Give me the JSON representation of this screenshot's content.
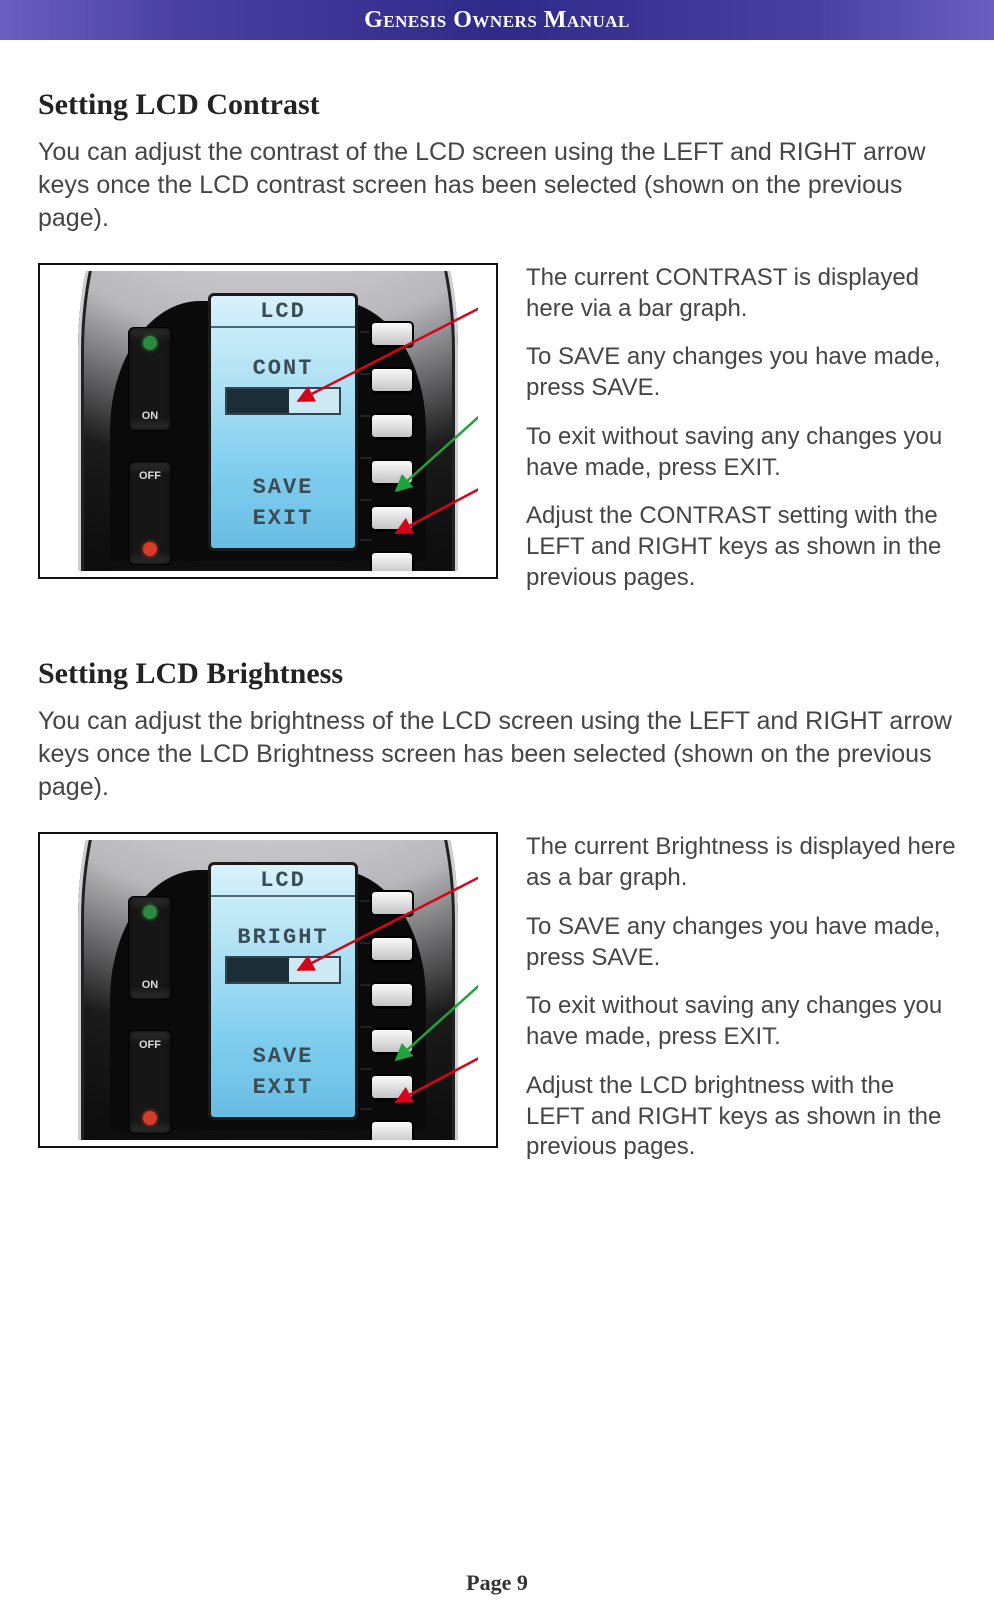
{
  "header": {
    "title": "Genesis Owners Manual"
  },
  "footer": {
    "page_label": "Page 9"
  },
  "section1": {
    "heading": "Setting LCD Contrast",
    "intro": "You can adjust the contrast of the LCD screen using the LEFT and RIGHT arrow keys once the LCD contrast screen has been selected (shown on the previous page).",
    "device": {
      "panel_title": "LCD",
      "field_label": "CONT",
      "save_label": "SAVE",
      "exit_label": "EXIT",
      "on_label": "ON",
      "off_label": "OFF"
    },
    "notes": {
      "n1": "The current CONTRAST is displayed here via a bar graph.",
      "n2": "To SAVE any changes you have made, press SAVE.",
      "n3": "To exit without saving any changes you have made, press EXIT.",
      "n4": "Adjust the CONTRAST setting with the LEFT and RIGHT keys as shown in the previous pages."
    }
  },
  "section2": {
    "heading": "Setting LCD Brightness",
    "intro": "You can adjust the brightness of the LCD screen using the LEFT and RIGHT arrow keys once the LCD Brightness screen has been selected (shown on the previous page).",
    "device": {
      "panel_title": "LCD",
      "field_label": "BRIGHT",
      "save_label": "SAVE",
      "exit_label": "EXIT",
      "on_label": "ON",
      "off_label": "OFF"
    },
    "notes": {
      "n1": "The current Brightness is displayed here as a bar graph.",
      "n2": "To SAVE any changes you have made, press SAVE.",
      "n3": "To exit without saving any changes you have made, press EXIT.",
      "n4": "Adjust the LCD brightness with the LEFT and RIGHT keys as shown in the previous pages."
    }
  }
}
